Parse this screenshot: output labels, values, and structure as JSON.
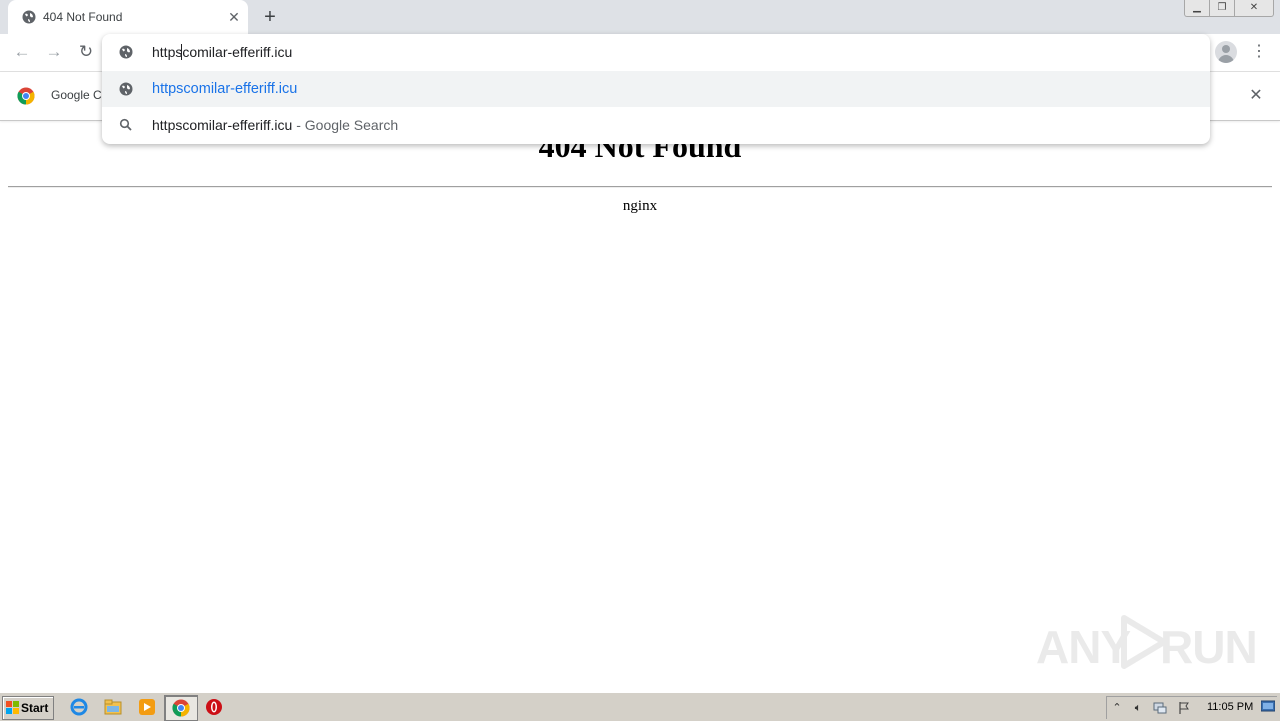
{
  "browser": {
    "tab": {
      "title": "404 Not Found"
    },
    "omnibox": {
      "input_before_caret": "https",
      "input_after_caret": "comilar-efferiff.icu",
      "suggestion_url": "httpscomilar-efferiff.icu",
      "search_query": "httpscomilar-efferiff.icu",
      "search_suffix": " - Google Search"
    },
    "infobar": {
      "text": "Google Chrome isn't your default browser"
    }
  },
  "page": {
    "heading": "404 Not Found",
    "server": "nginx"
  },
  "watermark": {
    "left": "ANY",
    "right": "RUN"
  },
  "taskbar": {
    "start_label": "Start",
    "clock": "11:05 PM"
  },
  "colors": {
    "link_blue": "#1a73e8",
    "tab_strip": "#dee1e6",
    "selected_row": "#f1f3f4"
  }
}
